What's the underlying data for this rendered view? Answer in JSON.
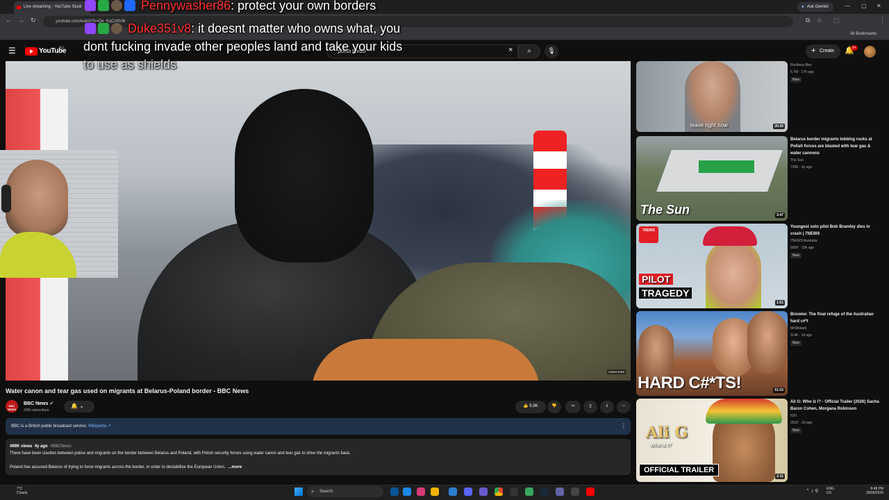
{
  "browser": {
    "active_tab_title": "Live streaming - YouTube Studi",
    "second_tab_title": "...",
    "url": "youtube.com/watch?v=Qe_KqCnNVlk",
    "ask_gemini_label": "Ask Gemini",
    "all_bookmarks_label": "All Bookmarks"
  },
  "youtube_header": {
    "logo_text": "YouTube",
    "country": "AU",
    "search_value": "polish border",
    "create_label": "Create",
    "notification_count": "9+"
  },
  "chat": {
    "message1": {
      "username": "Pennywasher86",
      "text": "protect your own borders"
    },
    "message2": {
      "username": "Duke351v8",
      "line1": "it doesnt matter who owns what, you",
      "line2": "dont fucking invade other peoples land and take your kids",
      "line3": "to use as shields"
    }
  },
  "video": {
    "subscribe_watermark": "SUBSCRIBE",
    "title": "Water canon and tear gas used on migrants at Belarus-Poland border - BBC News",
    "channel_name": "BBC News",
    "channel_avatar_text": "BBC NEWS",
    "channel_subs": "20M subscribers",
    "likes": "5.9K",
    "info_text": "BBC is a British public broadcast service.",
    "info_link": "Wikipedia",
    "description": {
      "views": "499K views",
      "age": "4y ago",
      "hashtag": "#BBCNews",
      "line1": "There have been clashes between police and migrants on the border between Belarus and Poland, with Polish security forces using water canon and tear gas to drive the migrants back.",
      "line2": "Poland has accused Belarus of trying to force migrants across the border, in order to destabilise the European Union.",
      "more_label": "...more"
    }
  },
  "recommendations": [
    {
      "title": "",
      "channel": "Reckless Ben",
      "stats": "5.7M · 17h ago",
      "new_badge": "New",
      "duration": "20:35",
      "thumb_text": "leave right now"
    },
    {
      "title": "Belarus border migrants lobbing rocks at Polish forces are blasted with tear gas & water cannons",
      "channel": "The Sun",
      "stats": "739K · 4y ago",
      "new_badge": "",
      "duration": "3:47",
      "thumb_text": "The Sun"
    },
    {
      "title": "Youngest solo pilot Bob Bramley dies in crash | 7NEWS",
      "channel": "7NEWS Australia",
      "stats": "500K · 10h ago",
      "new_badge": "New",
      "duration": "1:51",
      "thumb_text": "PILOT",
      "thumb_text2": "TRAGEDY",
      "thumb_logo": "7NEWS"
    },
    {
      "title": "Broome: The final refuge of the Australian hard c#*t",
      "channel": "MrSlikkant",
      "stats": "114K · 1d ago",
      "new_badge": "New",
      "duration": "51:33",
      "thumb_text": "HARD C#*TS!"
    },
    {
      "title": "Ali G: Who Iz I? - Official Trailer (2026) Sacha Baron Cohen, Morgana Robinson",
      "channel": "IGN",
      "stats": "351K · 2d ago",
      "new_badge": "New",
      "duration": "2:11",
      "thumb_text": "Ali G",
      "thumb_text2": "Who Iz I?",
      "thumb_badge": "OFFICIAL TRAILER"
    }
  ],
  "taskbar": {
    "weather_temp": "7°C",
    "weather_desc": "Cloudy",
    "search_label": "Search",
    "lang_line1": "ENG",
    "lang_line2": "US",
    "time": "8:48 PM",
    "date": "28/06/2026"
  },
  "colors": {
    "youtube_red": "#ff0000",
    "bg": "#0f0f0f",
    "info_panel": "#21314a",
    "chat_username": "#ff3030"
  }
}
